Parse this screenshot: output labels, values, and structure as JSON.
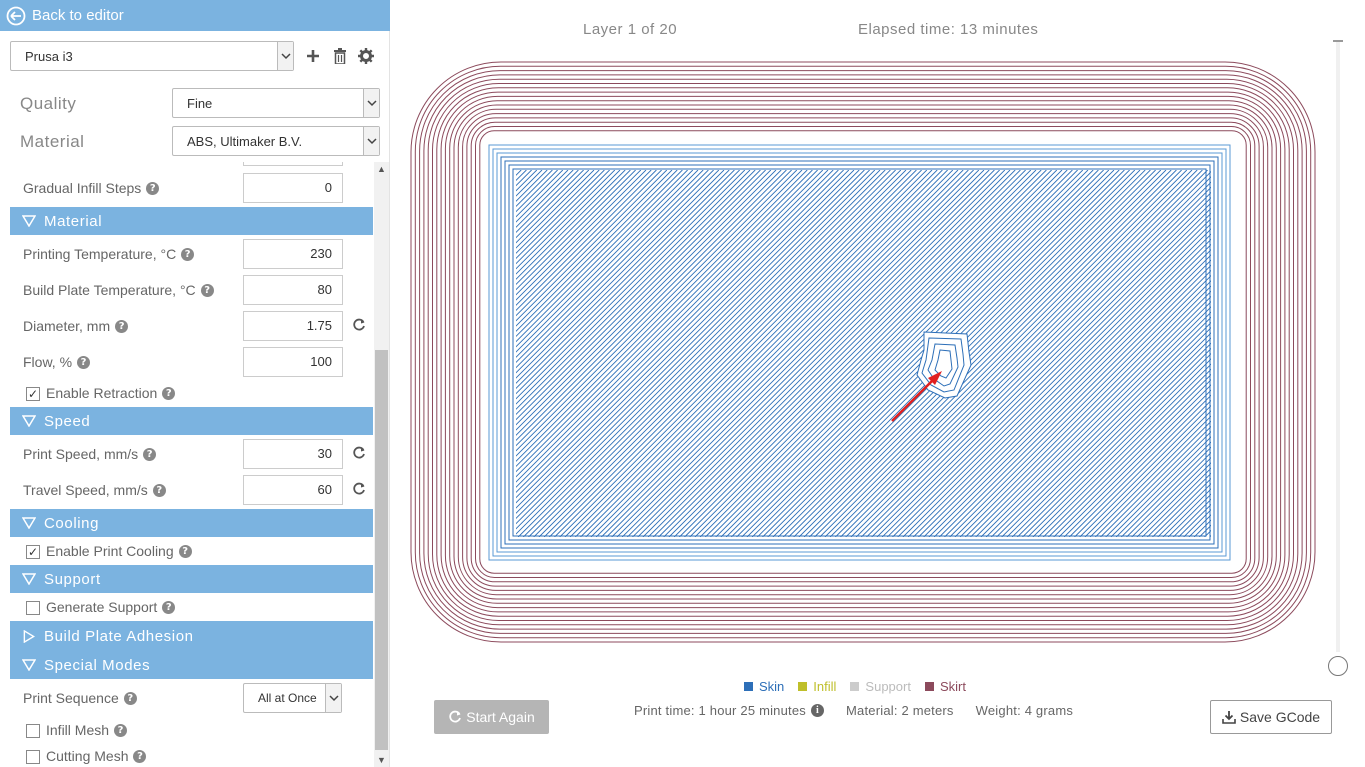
{
  "back_label": "Back to editor",
  "printer": {
    "selected": "Prusa i3"
  },
  "quality": {
    "label": "Quality",
    "selected": "Fine"
  },
  "material_select": {
    "label": "Material",
    "selected": "ABS, Ultimaker B.V."
  },
  "settings": {
    "gradual_infill": {
      "label": "Gradual Infill Steps",
      "value": "0"
    },
    "sec_material": "Material",
    "print_temp": {
      "label": "Printing Temperature, °C",
      "value": "230"
    },
    "plate_temp": {
      "label": "Build Plate Temperature, °C",
      "value": "80"
    },
    "diameter": {
      "label": "Diameter, mm",
      "value": "1.75"
    },
    "flow": {
      "label": "Flow, %",
      "value": "100"
    },
    "retraction": {
      "label": "Enable Retraction",
      "checked": true
    },
    "sec_speed": "Speed",
    "print_speed": {
      "label": "Print Speed, mm/s",
      "value": "30"
    },
    "travel_speed": {
      "label": "Travel Speed, mm/s",
      "value": "60"
    },
    "sec_cooling": "Cooling",
    "cooling": {
      "label": "Enable Print Cooling",
      "checked": true
    },
    "sec_support": "Support",
    "support": {
      "label": "Generate Support",
      "checked": false
    },
    "sec_adhesion": "Build Plate Adhesion",
    "sec_special": "Special Modes",
    "print_sequence": {
      "label": "Print Sequence",
      "selected": "All at Once"
    },
    "infill_mesh": {
      "label": "Infill Mesh",
      "checked": false
    },
    "cutting_mesh": {
      "label": "Cutting Mesh",
      "checked": false
    }
  },
  "preview": {
    "layer_text": "Layer 1 of 20",
    "elapsed_text": "Elapsed time: 13 minutes",
    "colors": {
      "skin": "#2d6fb8",
      "infill": "#bfbf2a",
      "support": "#cccccc",
      "skirt": "#8c4a5c"
    }
  },
  "legend": [
    {
      "label": "Skin",
      "color": "#2d6fb8"
    },
    {
      "label": "Infill",
      "color": "#bfbf2a"
    },
    {
      "label": "Support",
      "color": "#cccccc"
    },
    {
      "label": "Skirt",
      "color": "#8c4a5c"
    }
  ],
  "stats": {
    "print_time": "Print time: 1 hour 25 minutes",
    "material": "Material: 2 meters",
    "weight": "Weight: 4 grams"
  },
  "buttons": {
    "start_again": "Start Again",
    "save_gcode": "Save GCode"
  }
}
